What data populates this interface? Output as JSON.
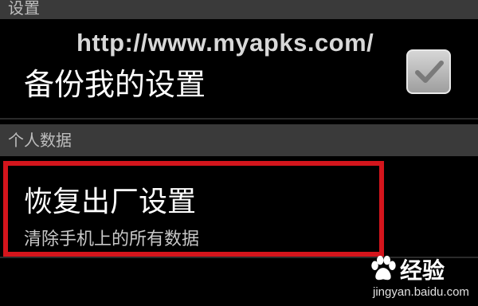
{
  "settings_header": "设置",
  "watermark_url": "http://www.myapks.com/",
  "backup_setting": {
    "title": "备份我的设置",
    "checked": true
  },
  "personal_header": "个人数据",
  "factory_reset": {
    "title": "恢复出厂设置",
    "subtitle": "清除手机上的所有数据"
  },
  "baidu_watermark": {
    "logo_text": "经验",
    "url": "jingyan.baidu.com"
  }
}
